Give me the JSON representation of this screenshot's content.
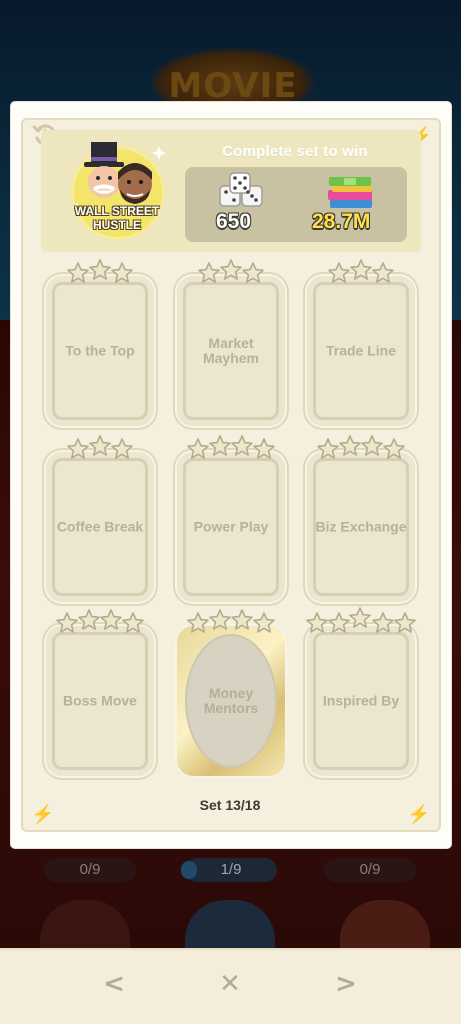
{
  "background": {
    "banner_text": "MOVIE",
    "progress": [
      "0/9",
      "1/9",
      "0/9"
    ]
  },
  "header": {
    "title": "Complete set to win",
    "badge_name": "WALL STREET HUSTLE",
    "reward_dice": "650",
    "reward_cash": "28.7M"
  },
  "cards": [
    {
      "label": "To the Top",
      "stars": 3
    },
    {
      "label": "Market Mayhem",
      "stars": 3
    },
    {
      "label": "Trade Line",
      "stars": 3
    },
    {
      "label": "Coffee Break",
      "stars": 3
    },
    {
      "label": "Power Play",
      "stars": 4
    },
    {
      "label": "Biz Exchange",
      "stars": 4
    },
    {
      "label": "Boss Move",
      "stars": 4
    },
    {
      "label": "Money Mentors",
      "stars": 4,
      "golden": true
    },
    {
      "label": "Inspired By",
      "stars": 5
    }
  ],
  "footer": {
    "set_label": "Set 13/18"
  },
  "nav": {
    "prev": "<",
    "close": "✕",
    "next": ">"
  },
  "colors": {
    "star_fill": "#efe7c9",
    "star_stroke": "#b3ab90",
    "accent_gold": "#ffe04a"
  }
}
